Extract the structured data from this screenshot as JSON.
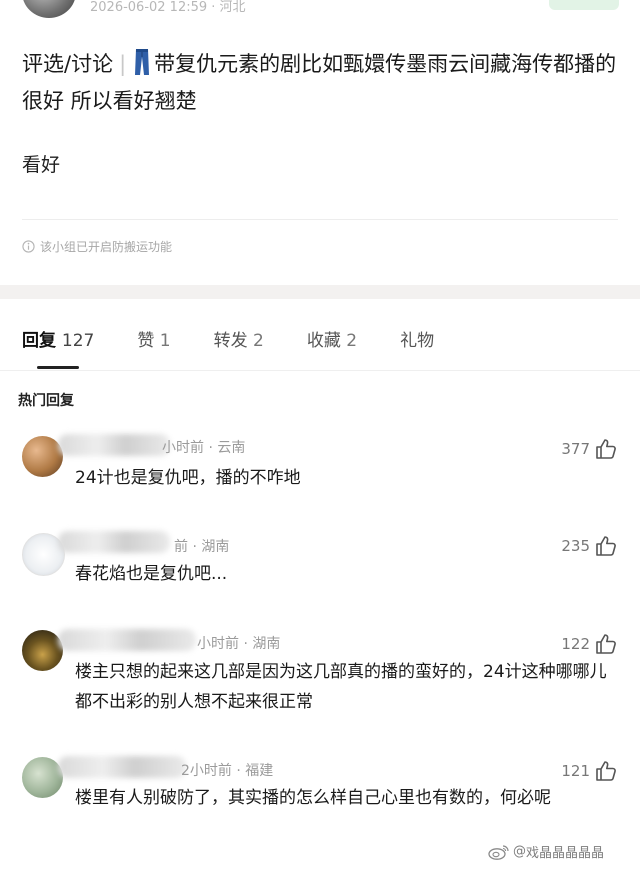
{
  "post": {
    "meta": "2026-06-02 12:59 · 河北",
    "title_tag": "评选/讨论",
    "title_separator": "|",
    "title_icon": "jeans-icon",
    "title_text": "带复仇元素的剧比如甄嬛传墨雨云间藏海传都播的很好 所以看好翘楚",
    "body": "看好",
    "notice": "该小组已开启防搬运功能"
  },
  "tabs": [
    {
      "label": "回复",
      "count": "127",
      "active": true
    },
    {
      "label": "赞",
      "count": "1"
    },
    {
      "label": "转发",
      "count": "2"
    },
    {
      "label": "收藏",
      "count": "2"
    },
    {
      "label": "礼物",
      "count": ""
    }
  ],
  "hot_label": "热门回复",
  "comments": [
    {
      "meta": "小时前 · 云南",
      "likes": "377",
      "text": "24计也是复仇吧，播的不咋地"
    },
    {
      "meta": "前 · 湖南",
      "likes": "235",
      "text": "春花焰也是复仇吧..."
    },
    {
      "meta": "小时前 · 湖南",
      "likes": "122",
      "text": "楼主只想的起来这几部是因为这几部真的播的蛮好的，24计这种哪哪儿都不出彩的别人想不起来很正常"
    },
    {
      "meta": "2小时前 · 福建",
      "likes": "121",
      "text": "楼里有人别破防了，其实播的怎么样自己心里也有数的，何必呢"
    }
  ],
  "watermark": "戏晶晶晶晶晶",
  "colors": {
    "accent_green": "#e2f3e6",
    "text_main": "#1a1a1a",
    "text_meta": "#9b9b9b"
  }
}
